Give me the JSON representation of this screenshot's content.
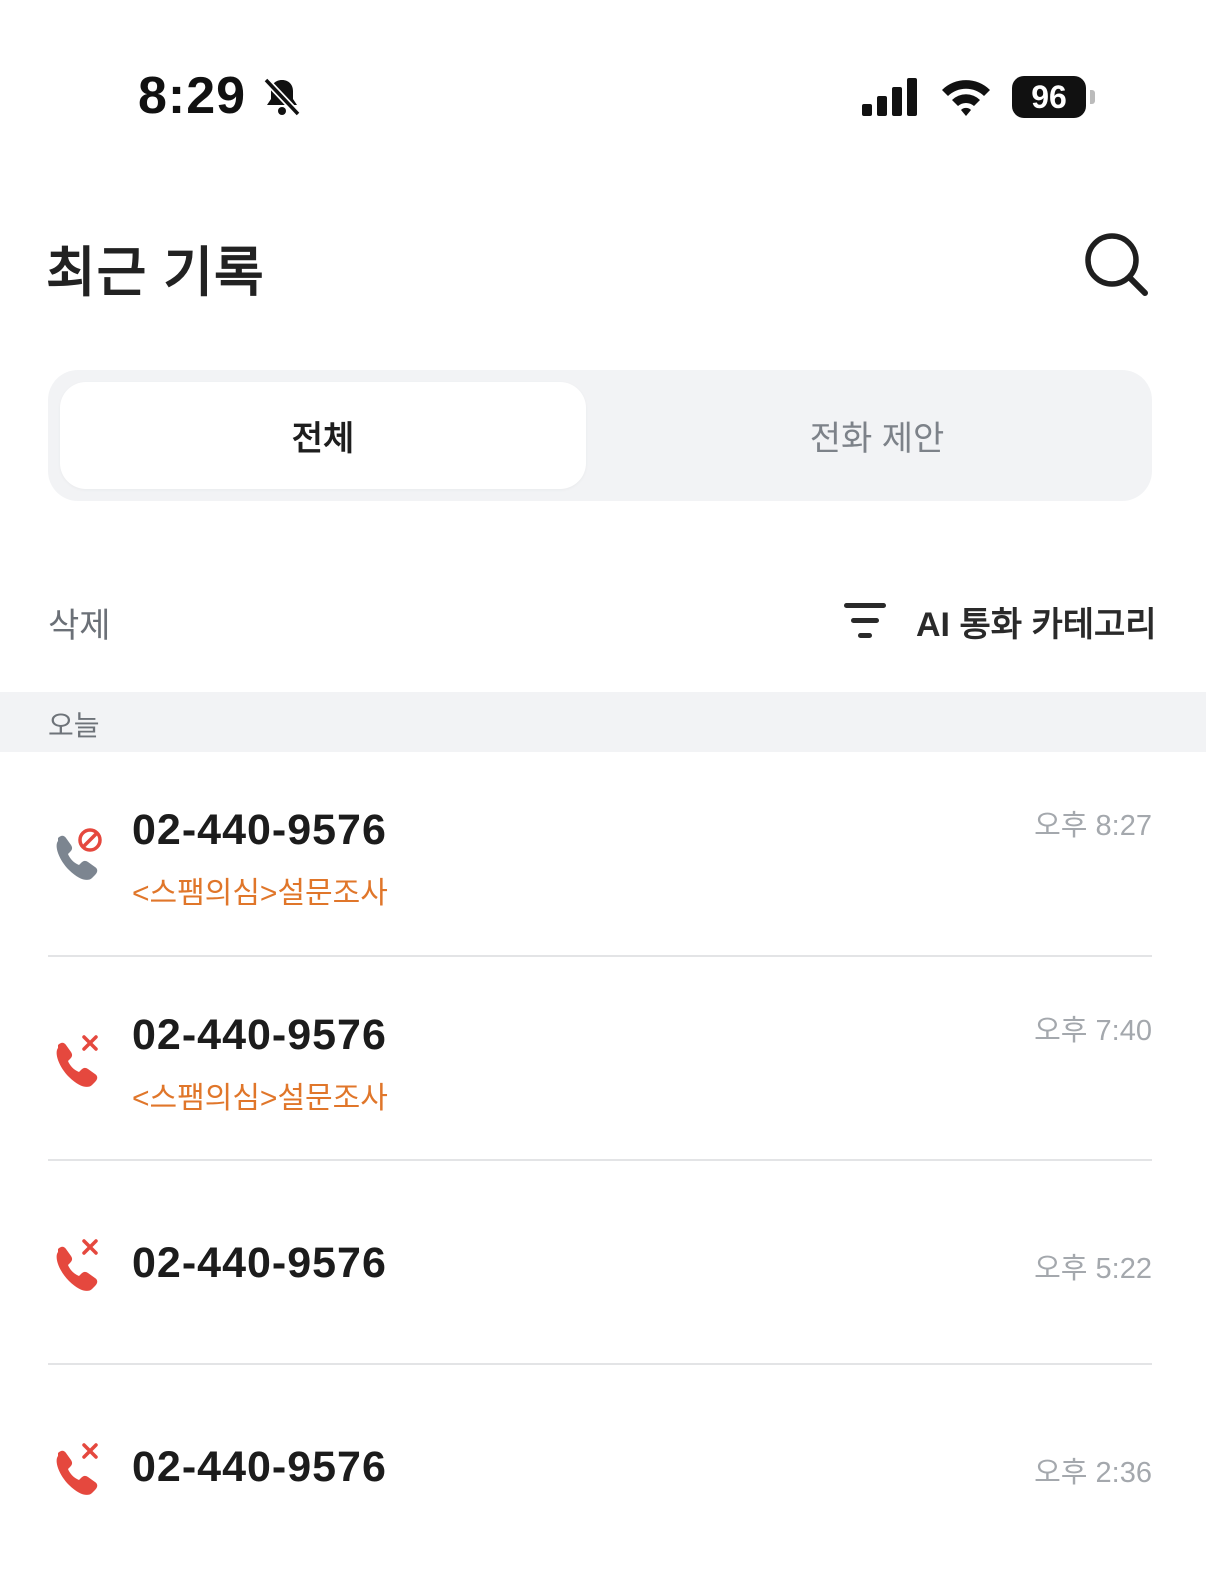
{
  "status_bar": {
    "time": "8:29",
    "battery": "96"
  },
  "header": {
    "title": "최근 기록"
  },
  "tabs": [
    {
      "label": "전체",
      "active": true
    },
    {
      "label": "전화 제안",
      "active": false
    }
  ],
  "toolbar": {
    "delete_label": "삭제",
    "filter_label": "AI 통화 카테고리"
  },
  "section": {
    "label": "오늘"
  },
  "calls": [
    {
      "number": "02-440-9576",
      "tag": "<스팸의심>설문조사",
      "time": "오후 8:27",
      "type": "blocked"
    },
    {
      "number": "02-440-9576",
      "tag": "<스팸의심>설문조사",
      "time": "오후 7:40",
      "type": "missed"
    },
    {
      "number": "02-440-9576",
      "time": "오후 5:22",
      "type": "missed"
    },
    {
      "number": "02-440-9576",
      "time": "오후 2:36",
      "type": "missed"
    }
  ],
  "colors": {
    "missed": "#e5483e",
    "blocked_phone": "#7c8590",
    "spam_tag": "#e0762a",
    "section_bg": "#f2f3f5"
  },
  "icons": {
    "blocked": "phone-blocked-icon",
    "missed": "phone-missed-icon"
  }
}
